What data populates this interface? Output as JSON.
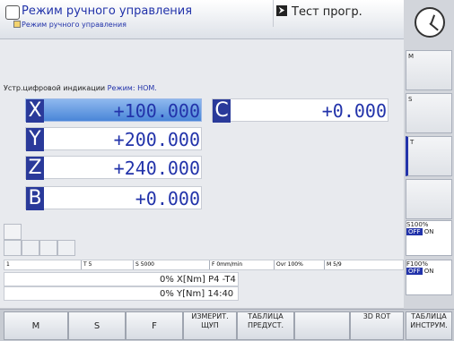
{
  "header": {
    "title": "Режим ручного управления",
    "subtitle": "Режим ручного управления",
    "program_mode_label": "Тест прогр."
  },
  "panel": {
    "status_prefix": "Устр.цифровой индикации",
    "status_mode": "Режим: НОМ."
  },
  "axes": {
    "x": {
      "name": "X",
      "value": "+100.000"
    },
    "y": {
      "name": "Y",
      "value": "+200.000"
    },
    "z": {
      "name": "Z",
      "value": "+240.000"
    },
    "b": {
      "name": "B",
      "value": "+0.000"
    },
    "c": {
      "name": "C",
      "value": "+0.000"
    }
  },
  "bottom_status": {
    "item1": "1",
    "tool": "T 5",
    "spindle": "S 5000",
    "feed": "F 0mm/min",
    "ovr": "Ovr 100%",
    "m": "M 5/9"
  },
  "info_rows": {
    "row1": "0% X[Nm] P4  -T4",
    "row2": "0% Y[Nm] 14:40"
  },
  "right_keys": {
    "m": "M",
    "s": "S",
    "t": "T"
  },
  "overrides": {
    "s_label": "S100%",
    "s_state": "OFF",
    "s_on": "ON",
    "f_label": "F100%",
    "f_state": "OFF",
    "f_on": "ON"
  },
  "softkeys": {
    "m": "M",
    "s": "S",
    "f": "F",
    "measure_line1": "ИЗМЕРИТ.",
    "measure_line2": "ЩУП",
    "table_line1": "ТАБЛИЦА",
    "table_line2": "ПРЕДУСТ.",
    "rot3d": "3D ROT",
    "tooltable_line1": "ТАБЛИЦА",
    "tooltable_line2": "ИНСТРУМ."
  }
}
